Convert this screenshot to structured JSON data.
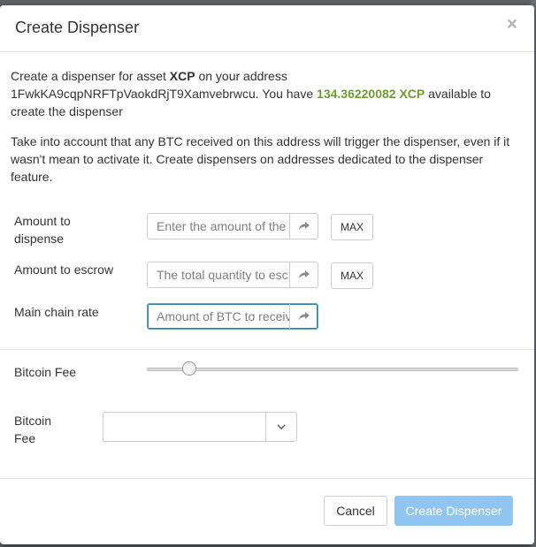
{
  "modal": {
    "title": "Create Dispenser",
    "close_glyph": "×",
    "intro": {
      "part1": "Create a dispenser for asset ",
      "asset": "XCP",
      "part2": " on your address",
      "address": "1FwkKA9cqpNRFTpVaokdRjT9Xamvebrwcu",
      "part3": ". You have ",
      "balance": "134.36220082 XCP",
      "part4": " available to create the dispenser"
    },
    "warning": "Take into account that any BTC received on this address will trigger the dispenser, even if it wasn't mean to activate it. Create dispensers on addresses dedicated to the dispenser feature."
  },
  "form": {
    "amount_dispense": {
      "label_line1": "Amount to",
      "label_line2": "dispense",
      "placeholder": "Enter the amount of the",
      "max_label": "MAX"
    },
    "amount_escrow": {
      "label": "Amount to escrow",
      "placeholder": "The total quantity to esc",
      "max_label": "MAX"
    },
    "main_chain_rate": {
      "label": "Main chain rate",
      "placeholder": "Amount of BTC to receiv"
    },
    "bitcoin_fee_slider": {
      "label": "Bitcoin Fee",
      "level": 0.1
    },
    "bitcoin_fee_select": {
      "label_line1": "Bitcoin",
      "label_line2": "Fee",
      "value": ""
    }
  },
  "footer": {
    "cancel_label": "Cancel",
    "create_label": "Create Dispenser"
  },
  "icons": {
    "addon": "share-arrow-icon",
    "caret": "chevron-down-icon"
  },
  "colors": {
    "accent_green": "#6f9b2e",
    "primary_disabled": "#8fc5f0",
    "focus_border": "#2d7eb3"
  }
}
